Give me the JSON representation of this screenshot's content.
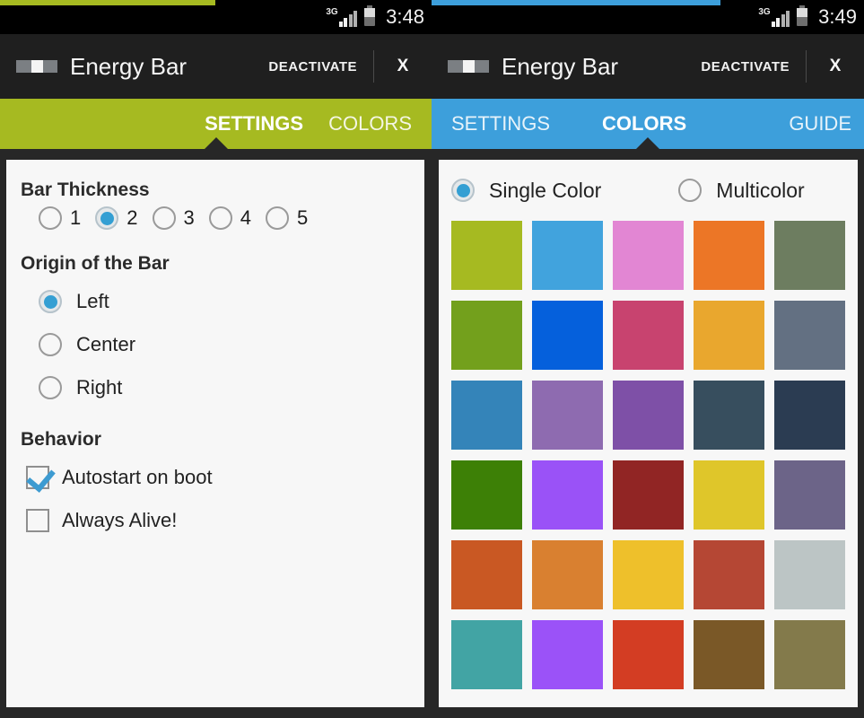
{
  "theme": {
    "green_accent": "#a6ba21",
    "blue_accent": "#3d9fdb",
    "dark_chrome": "#272727",
    "appbar_bg": "#1f1f1f",
    "card_bg": "#f7f7f7",
    "radio_selected": "#349fd3"
  },
  "left_phone": {
    "statusbar": {
      "network": "3G",
      "time": "3:48"
    },
    "appbar": {
      "icon": "energy-bar-icon",
      "title": "Energy Bar",
      "deactivate_label": "DEACTIVATE",
      "close_label": "X"
    },
    "tabs": [
      {
        "label": "SETTINGS",
        "active": true
      },
      {
        "label": "COLORS",
        "active": false
      }
    ],
    "settings": {
      "bar_thickness": {
        "heading": "Bar Thickness",
        "options": [
          "1",
          "2",
          "3",
          "4",
          "5"
        ],
        "selected": "2"
      },
      "origin": {
        "heading": "Origin of the Bar",
        "options": [
          "Left",
          "Center",
          "Right"
        ],
        "selected": "Left"
      },
      "behavior": {
        "heading": "Behavior",
        "options": [
          {
            "label": "Autostart on boot",
            "checked": true
          },
          {
            "label": "Always Alive!",
            "checked": false
          }
        ]
      }
    }
  },
  "right_phone": {
    "statusbar": {
      "network": "3G",
      "time": "3:49"
    },
    "appbar": {
      "icon": "energy-bar-icon",
      "title": "Energy Bar",
      "deactivate_label": "DEACTIVATE",
      "close_label": "X"
    },
    "tabs": [
      {
        "label": "SETTINGS",
        "active": false
      },
      {
        "label": "COLORS",
        "active": true
      },
      {
        "label": "GUIDE",
        "active": false
      }
    ],
    "colors": {
      "mode": {
        "options": [
          "Single Color",
          "Multicolor"
        ],
        "selected": "Single Color"
      },
      "palette": [
        [
          "#a6ba21",
          "#41a3dd",
          "#e286d3",
          "#ec7626",
          "#6d7d60"
        ],
        [
          "#73a01c",
          "#0560dc",
          "#c8436f",
          "#e9a72e",
          "#637082"
        ],
        [
          "#3484b9",
          "#8e6bb0",
          "#7e50a7",
          "#374e5e",
          "#2b3c52"
        ],
        [
          "#3d8006",
          "#9a52f7",
          "#912524",
          "#dfc62a",
          "#6c6488"
        ],
        [
          "#c95823",
          "#d98030",
          "#eec02b",
          "#b54734",
          "#bcc5c5"
        ],
        [
          "#42a4a4",
          "#9b52f8",
          "#d33d23",
          "#7a5827",
          "#837a4b"
        ]
      ]
    }
  }
}
